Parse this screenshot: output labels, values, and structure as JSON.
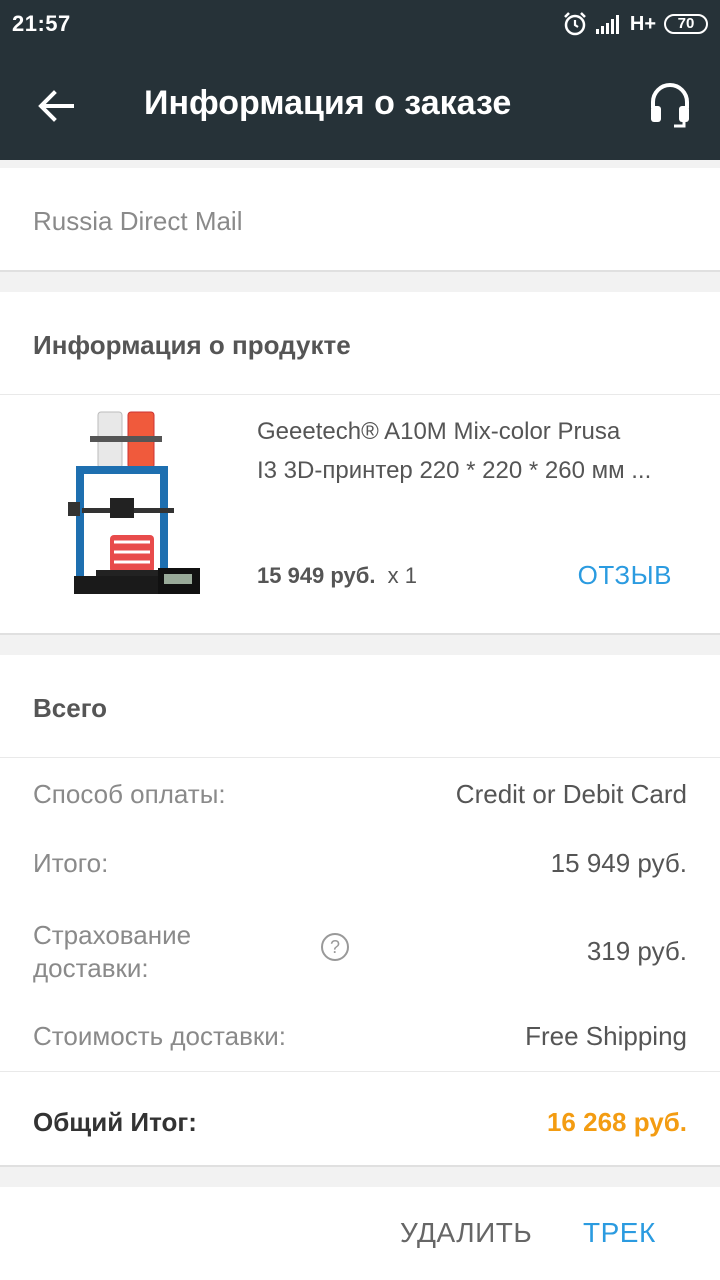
{
  "status_bar": {
    "time": "21:57",
    "network": "H+",
    "battery": "70",
    "icons": [
      "alarm-icon",
      "signal-icon",
      "battery-icon"
    ]
  },
  "app_bar": {
    "title": "Информация о заказе",
    "icons": [
      "back-arrow-icon",
      "headset-icon"
    ]
  },
  "shipping": {
    "method": "Russia Direct Mail"
  },
  "product_section": {
    "title": "Информация о продукте",
    "product": {
      "name_line1": "Geeetech® A10M Mix-color Prusa",
      "name_line2": "I3 3D-принтер 220 * 220 * 260 мм ...",
      "price": "15 949 руб.",
      "quantity": "x 1",
      "review_label": "ОТЗЫВ"
    }
  },
  "totals": {
    "title": "Всего",
    "payment_method_label": "Способ оплаты:",
    "payment_method_value": "Credit or Debit Card",
    "subtotal_label": "Итого:",
    "subtotal_value": "15 949 руб.",
    "insurance_label_line1": "Страхование",
    "insurance_label_line2": "доставки:",
    "insurance_value": "319 руб.",
    "help_icon_glyph": "?",
    "shipping_cost_label": "Стоимость доставки:",
    "shipping_cost_value": "Free Shipping",
    "grand_total_label": "Общий Итог:",
    "grand_total_value": "16 268 руб."
  },
  "actions": {
    "delete_label": "УДАЛИТЬ",
    "track_label": "ТРЕК"
  },
  "colors": {
    "header_bg": "#263238",
    "accent_blue": "#2b9be0",
    "total_orange": "#f39c12"
  }
}
